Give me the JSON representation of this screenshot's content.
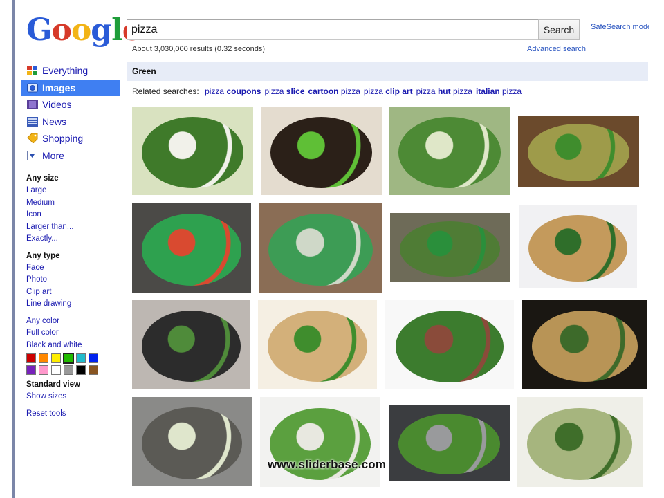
{
  "logo": {
    "letters": [
      "G",
      "o",
      "o",
      "g",
      "l",
      "e"
    ],
    "colors": [
      "#2a5bd7",
      "#d63a2a",
      "#f2b417",
      "#2a5bd7",
      "#1f9d3a",
      "#d63a2a"
    ]
  },
  "search": {
    "query": "pizza",
    "button_label": "Search",
    "safesearch_label": "SafeSearch moderate",
    "stats": "About 3,030,000 results (0.32 seconds)",
    "advanced_label": "Advanced search"
  },
  "nav": {
    "items": [
      {
        "label": "Everything",
        "icon": "everything-icon",
        "active": false
      },
      {
        "label": "Images",
        "icon": "camera-icon",
        "active": true
      },
      {
        "label": "Videos",
        "icon": "film-icon",
        "active": false
      },
      {
        "label": "News",
        "icon": "newspaper-icon",
        "active": false
      },
      {
        "label": "Shopping",
        "icon": "tag-icon",
        "active": false
      },
      {
        "label": "More",
        "icon": "more-dropdown-icon",
        "active": false
      }
    ]
  },
  "tools": {
    "size_header": "Any size",
    "size_options": [
      "Large",
      "Medium",
      "Icon",
      "Larger than...",
      "Exactly..."
    ],
    "type_header": "Any type",
    "type_options": [
      "Face",
      "Photo",
      "Clip art",
      "Line drawing"
    ],
    "color_options": [
      "Any color",
      "Full color",
      "Black and white"
    ],
    "swatches": [
      "#cc0000",
      "#ff8800",
      "#ffee00",
      "#22bb00",
      "#22bbcc",
      "#0022ee",
      "#7722bb",
      "#ff99cc",
      "#ffffff",
      "#999999",
      "#000000",
      "#885522"
    ],
    "selected_swatch": 3,
    "view_header": "Standard view",
    "show_sizes": "Show sizes",
    "reset": "Reset tools"
  },
  "results": {
    "title": "Green",
    "related_prefix": "Related searches:",
    "related": [
      {
        "pre": "pizza ",
        "bold": "coupons",
        "post": ""
      },
      {
        "pre": "pizza ",
        "bold": "slice",
        "post": ""
      },
      {
        "pre": "",
        "bold": "cartoon",
        "post": " pizza"
      },
      {
        "pre": "pizza ",
        "bold": "clip art",
        "post": ""
      },
      {
        "pre": "pizza ",
        "bold": "hut",
        "post": " pizza"
      },
      {
        "pre": "",
        "bold": "italian",
        "post": " pizza"
      }
    ]
  },
  "images": [
    {
      "name": "image-green-pizza-1",
      "bg": "#d9e2c0",
      "plate": "#3f7a2a",
      "accent": "#f1f1ea"
    },
    {
      "name": "image-green-pizza-2",
      "bg": "#e4dccf",
      "plate": "#2b2018",
      "accent": "#5fbf36"
    },
    {
      "name": "image-green-pizza-3",
      "bg": "#9fb783",
      "plate": "#4d8a35",
      "accent": "#dfe7c8"
    },
    {
      "name": "image-green-pizza-4",
      "bg": "#6b4a2c",
      "plate": "#9e9b4a",
      "accent": "#3f8d2d"
    },
    {
      "name": "image-green-pizza-5",
      "bg": "#4b4a47",
      "plate": "#2ea14f",
      "accent": "#d94a30"
    },
    {
      "name": "image-green-pizza-6",
      "bg": "#8a6d55",
      "plate": "#3d9c55",
      "accent": "#cfd8c8"
    },
    {
      "name": "image-green-pizza-7",
      "bg": "#6e6b58",
      "plate": "#4f7c35",
      "accent": "#2a8f3b"
    },
    {
      "name": "image-green-pizza-8",
      "bg": "#f1f1f3",
      "plate": "#c49a5c",
      "accent": "#2f6e2a"
    },
    {
      "name": "image-green-pizza-9",
      "bg": "#bdb7b2",
      "plate": "#2c2c2c",
      "accent": "#4f8b3a"
    },
    {
      "name": "image-green-pizza-10",
      "bg": "#f5efe3",
      "plate": "#d3b07a",
      "accent": "#3f8d2d"
    },
    {
      "name": "image-green-pizza-11",
      "bg": "#f8f8f8",
      "plate": "#3c7c2e",
      "accent": "#8a4b3a"
    },
    {
      "name": "image-green-pizza-12",
      "bg": "#1a1712",
      "plate": "#b89456",
      "accent": "#3d6a2a"
    },
    {
      "name": "image-green-pizza-13",
      "bg": "#8a8a88",
      "plate": "#5b5a55",
      "accent": "#dfe6cc"
    },
    {
      "name": "image-green-pizza-14",
      "bg": "#f2f2f0",
      "plate": "#5ba03f",
      "accent": "#e8e8e0"
    },
    {
      "name": "image-green-pizza-15",
      "bg": "#3b3d40",
      "plate": "#4a8a2f",
      "accent": "#999a9c"
    },
    {
      "name": "image-green-pizza-16",
      "bg": "#efefe8",
      "plate": "#a6b57e",
      "accent": "#3f6e2a"
    }
  ],
  "watermark": "www.sliderbase.com"
}
